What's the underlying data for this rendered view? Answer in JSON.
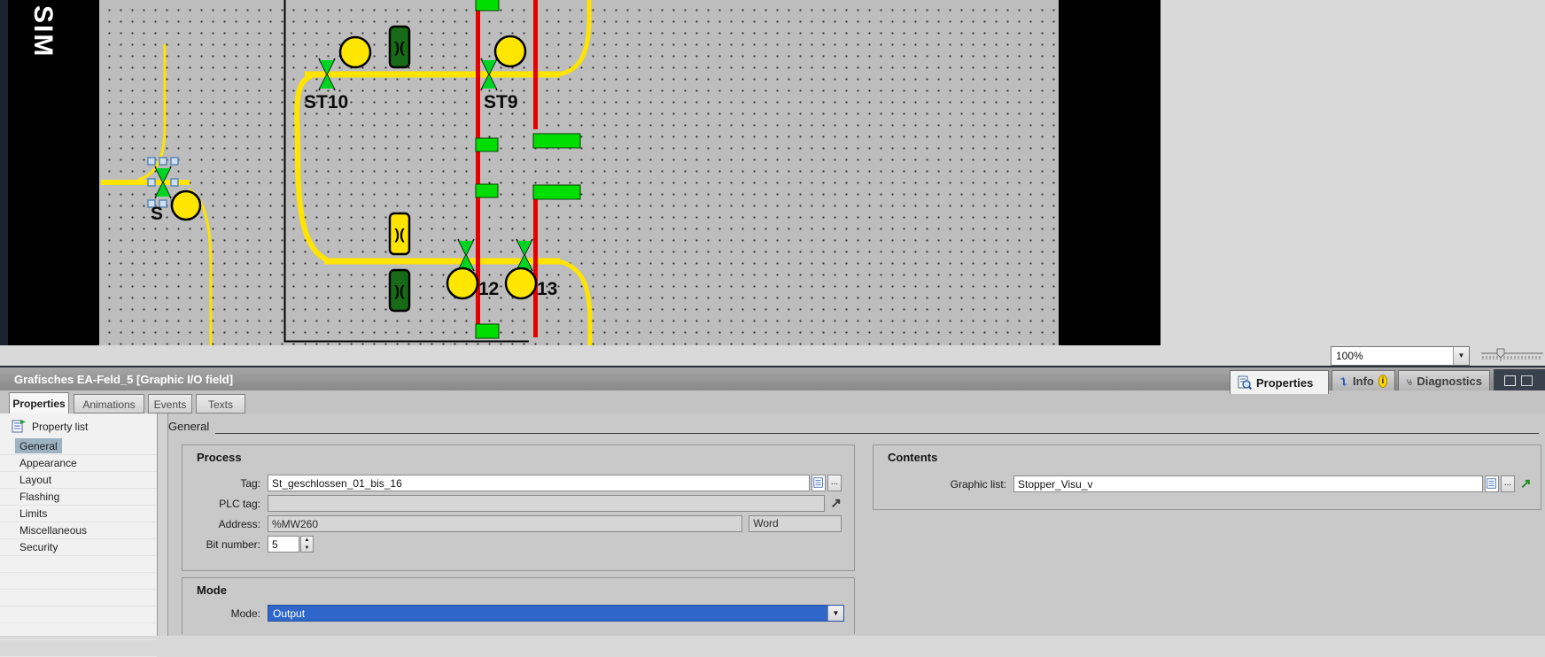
{
  "canvas": {
    "sim_label": "SIM",
    "stations": [
      {
        "label": "ST10"
      },
      {
        "label": "ST9"
      },
      {
        "label": "12"
      },
      {
        "label": "13"
      },
      {
        "label": "S"
      }
    ],
    "sensor_glyph": ")("
  },
  "zoom_bar": {
    "zoom_value": "100%"
  },
  "inspector": {
    "title": "Grafisches EA-Feld_5 [Graphic I/O field]",
    "dock_tabs": [
      {
        "label": "Properties"
      },
      {
        "label": "Info"
      },
      {
        "label": "Diagnostics"
      }
    ],
    "info_badge": "i",
    "tabs": [
      {
        "label": "Properties"
      },
      {
        "label": "Animations"
      },
      {
        "label": "Events"
      },
      {
        "label": "Texts"
      }
    ],
    "property_list": {
      "header": "Property list",
      "items": [
        "General",
        "Appearance",
        "Layout",
        "Flashing",
        "Limits",
        "Miscellaneous",
        "Security"
      ],
      "selected": "General"
    },
    "general": {
      "section_title": "General",
      "process": {
        "title": "Process",
        "tag_label": "Tag:",
        "tag_value": "St_geschlossen_01_bis_16",
        "plc_tag_label": "PLC tag:",
        "plc_tag_value": "",
        "address_label": "Address:",
        "address_value": "%MW260",
        "address_type": "Word",
        "bit_number_label": "Bit number:",
        "bit_number_value": "5"
      },
      "mode": {
        "title": "Mode",
        "mode_label": "Mode:",
        "mode_value": "Output"
      },
      "contents": {
        "title": "Contents",
        "graphic_list_label": "Graphic list:",
        "graphic_list_value": "Stopper_Visu_v"
      }
    }
  },
  "colors": {
    "accent_blue": "#2e66c9",
    "sidebar_selection": "#9db3c2",
    "canvas_yellow": "#ffe400",
    "canvas_red": "#e60000",
    "canvas_green": "#00dd00",
    "info_badge_yellow": "#ffd500"
  }
}
